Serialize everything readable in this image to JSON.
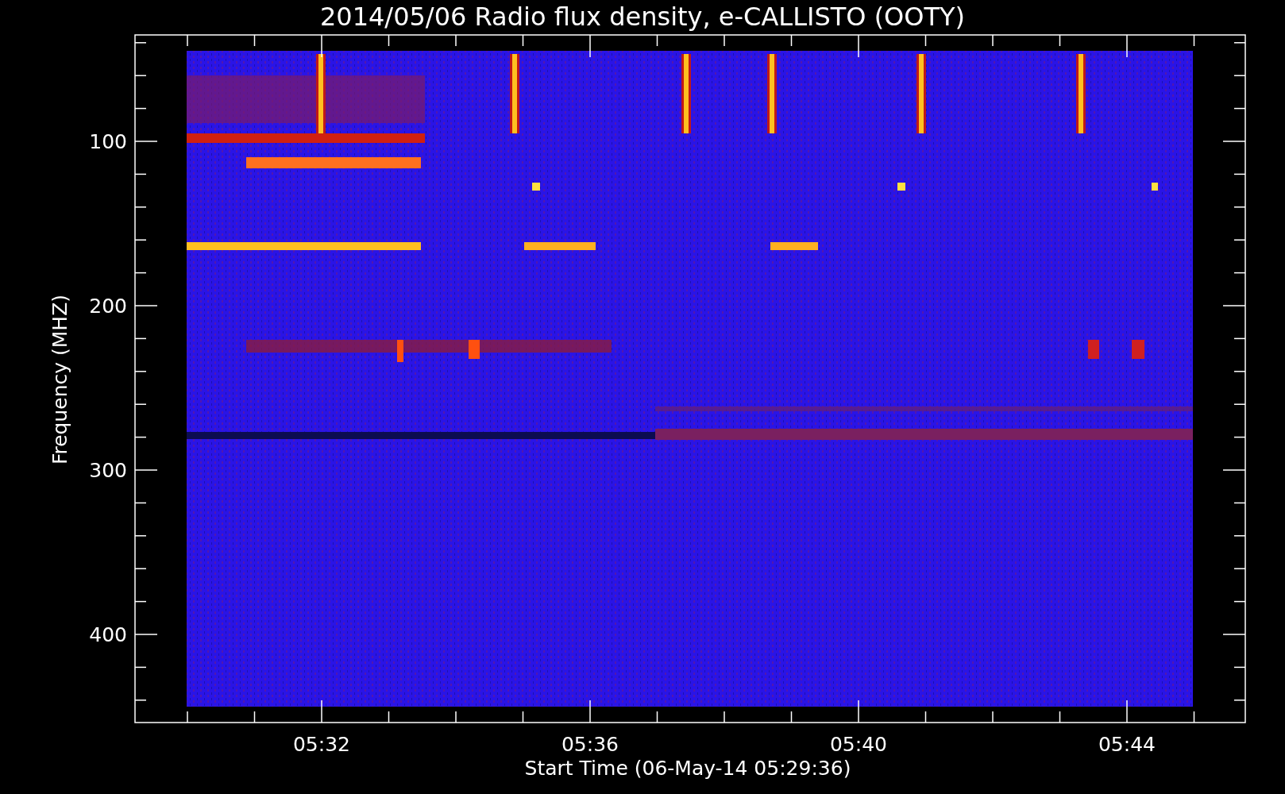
{
  "title": "2014/05/06  Radio flux density, e-CALLISTO (OOTY)",
  "y_axis": {
    "label": "Frequency (MHZ)",
    "ticks": [
      "100",
      "200",
      "300",
      "400"
    ]
  },
  "x_axis": {
    "label": "Start Time (06-May-14 05:29:36)",
    "ticks": [
      "05:32",
      "05:36",
      "05:40",
      "05:44"
    ]
  }
}
